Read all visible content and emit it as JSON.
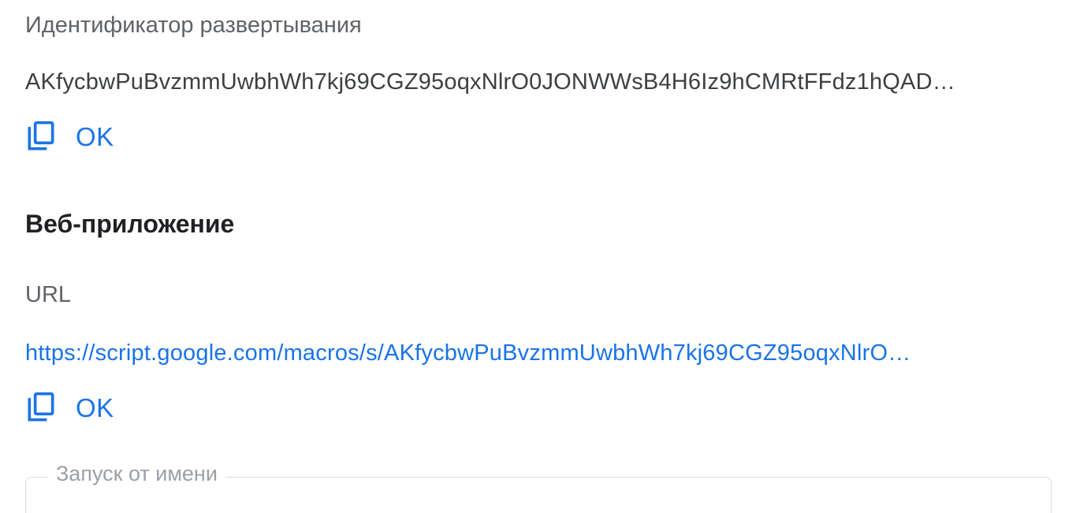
{
  "deployment": {
    "id_label": "Идентификатор развертывания",
    "id_value": "AKfycbwPuBvzmmUwbhWh7kj69CGZ95oqxNlrO0JONWWsB4H6Iz9hCMRtFFdz1hQAD…",
    "copy_label": "OK"
  },
  "web_app": {
    "section_title": "Веб-приложение",
    "url_label": "URL",
    "url_value": "https://script.google.com/macros/s/AKfycbwPuBvzmmUwbhWh7kj69CGZ95oqxNlrO…",
    "copy_label": "OK",
    "execute_as_label": "Запуск от имени"
  },
  "colors": {
    "accent": "#1a73e8",
    "label": "#5f6368",
    "text": "#3c4043",
    "heading": "#202124",
    "border": "#dadce0"
  },
  "icons": {
    "copy": "copy-icon"
  }
}
